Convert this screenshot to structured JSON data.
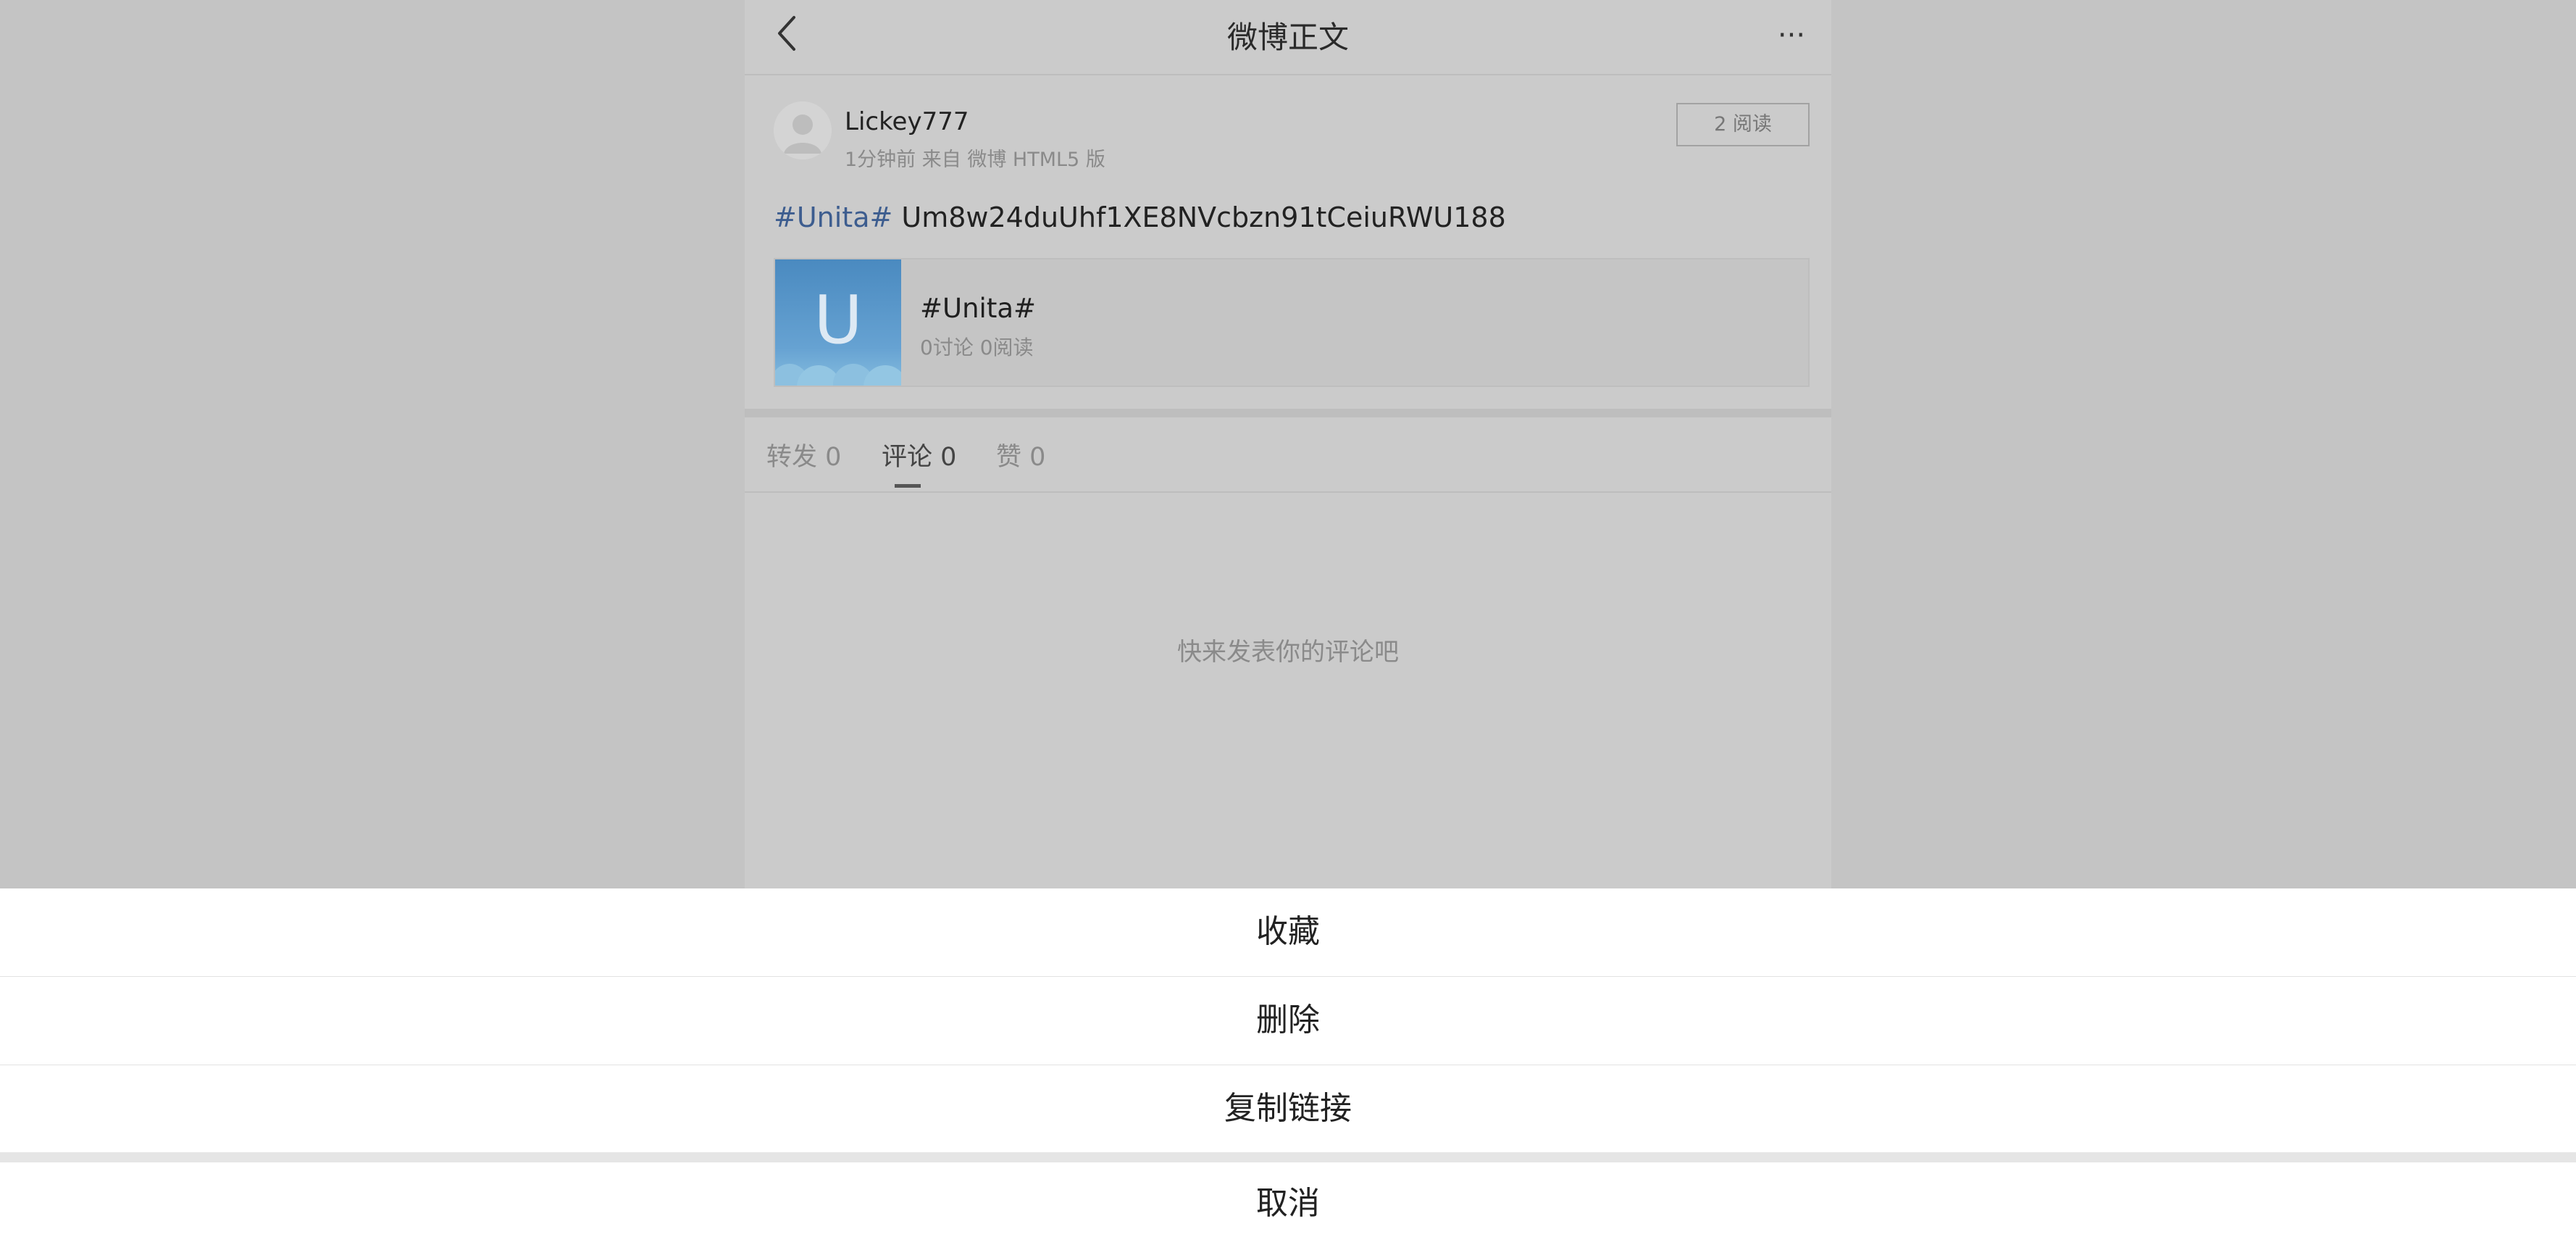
{
  "nav": {
    "title": "微博正文",
    "back_icon": "chevron-left-icon",
    "more_icon": "more-horizontal-icon",
    "more_glyph": "···"
  },
  "post": {
    "username": "Lickey777",
    "meta": "1分钟前 来自 微博 HTML5 版",
    "read_button": "2 阅读",
    "topic": "#Unita#",
    "text": " Um8w24duUhf1XE8NVcbzn91tCeiuRWU188"
  },
  "card": {
    "thumb_letter": "U",
    "title": "#Unita#",
    "subtitle": "0讨论 0阅读"
  },
  "tabs": [
    {
      "label": "转发 0"
    },
    {
      "label": "评论 0"
    },
    {
      "label": "赞 0"
    }
  ],
  "empty_hint": "快来发表你的评论吧",
  "sheet": {
    "favorite": "收藏",
    "delete": "删除",
    "copy_link": "复制链接",
    "cancel": "取消"
  },
  "colors": {
    "topic_link": "#3d5d8f",
    "thumb_blue": "#4a8ac0",
    "overlay_bg": "#c4c4c4",
    "sheet_bg": "#ffffff"
  }
}
